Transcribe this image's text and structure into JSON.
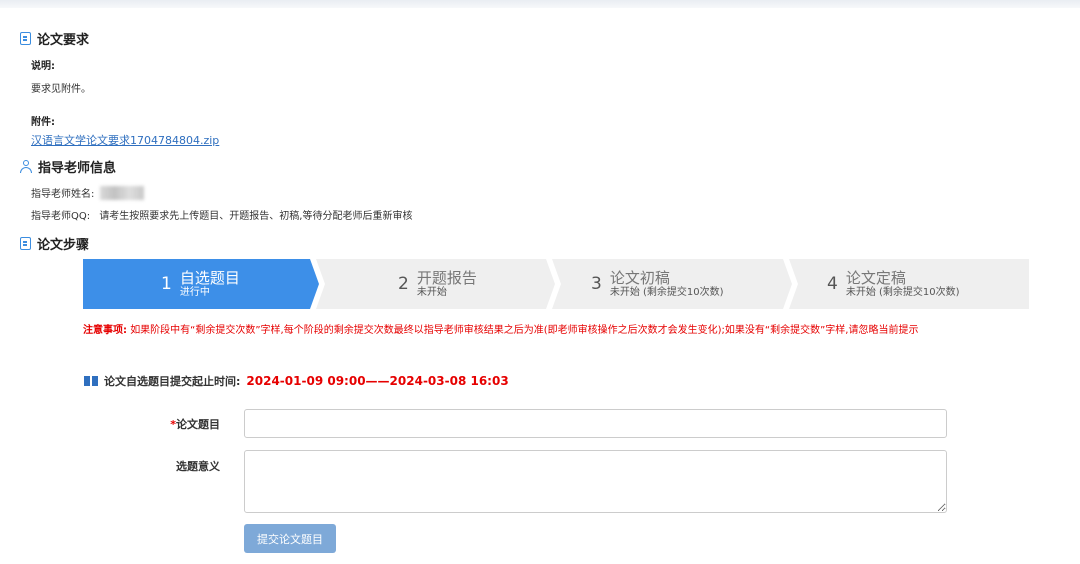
{
  "requirements": {
    "title": "论文要求",
    "desc_label": "说明:",
    "desc_text": "要求见附件。",
    "attachment_label": "附件:",
    "attachment_link": "汉语言文学论文要求1704784804.zip"
  },
  "advisor": {
    "title": "指导老师信息",
    "name_label": "指导老师姓名:",
    "qq_label": "指导老师QQ:",
    "qq_text": "请考生按照要求先上传题目、开题报告、初稿,等待分配老师后重新审核"
  },
  "steps_section": {
    "title": "论文步骤",
    "steps": [
      {
        "num": "1",
        "name": "自选题目",
        "status": "进行中"
      },
      {
        "num": "2",
        "name": "开题报告",
        "status": "未开始"
      },
      {
        "num": "3",
        "name": "论文初稿",
        "status": "未开始 (剩余提交10次数)"
      },
      {
        "num": "4",
        "name": "论文定稿",
        "status": "未开始 (剩余提交10次数)"
      }
    ]
  },
  "notice": {
    "label": "注意事项:",
    "text": "如果阶段中有“剩余提交次数”字样,每个阶段的剩余提交次数最终以指导老师审核结果之后为准(即老师审核操作之后次数才会发生变化);如果没有“剩余提交数”字样,请忽略当前提示"
  },
  "time": {
    "label": "论文自选题目提交起止时间:",
    "value": "2024-01-09 09:00——2024-03-08 16:03"
  },
  "form": {
    "required_mark": "*",
    "title_label": "论文题目",
    "title_value": "",
    "meaning_label": "选题意义",
    "meaning_value": "",
    "submit_label": "提交论文题目"
  },
  "colors": {
    "accent": "#3b8de0",
    "active_step": "#3d8fe8",
    "inactive_step": "#efefef",
    "notice": "#e60000",
    "button": "#7ea9d8"
  }
}
